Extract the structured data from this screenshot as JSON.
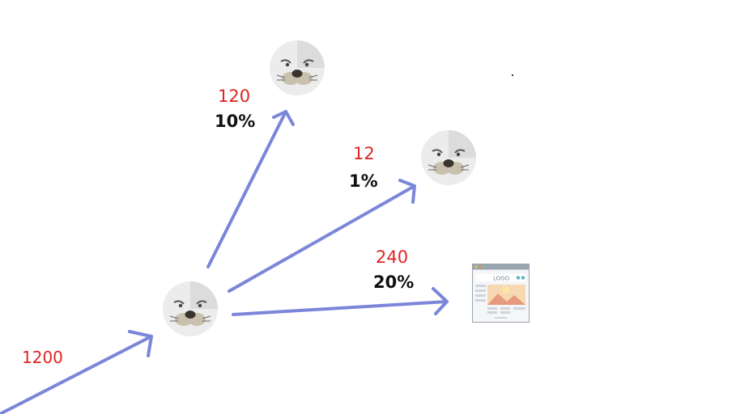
{
  "colors": {
    "arrow": "#7B86D9",
    "count": "#e02424",
    "percent": "#111111"
  },
  "icons": {
    "seal": "seal-face-icon",
    "webpage": "webpage-logo-icon"
  },
  "labels": {
    "input": "1200",
    "to_seal_top": {
      "count": "120",
      "percent": "10%"
    },
    "to_seal_mid": {
      "count": "12",
      "percent": "1%"
    },
    "to_webpage": {
      "count": "240",
      "percent": "20%"
    }
  },
  "webpage_icon": {
    "logo_text": "LOGO"
  }
}
